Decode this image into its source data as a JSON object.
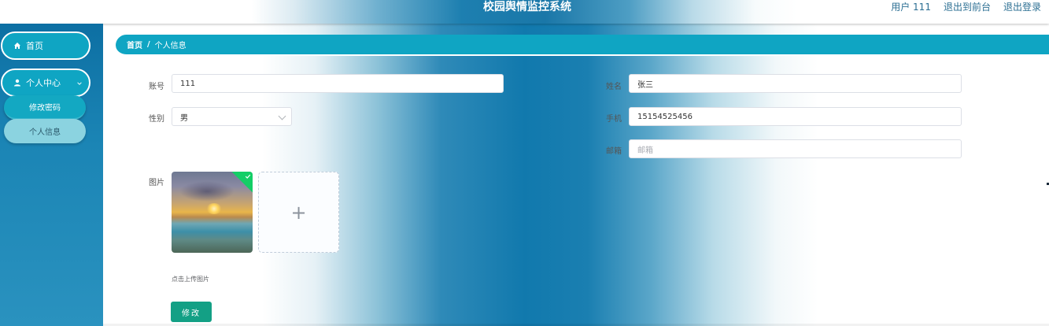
{
  "header": {
    "title": "校园舆情监控系统",
    "user_label": "用户 111",
    "to_front_label": "退出到前台",
    "logout_label": "退出登录"
  },
  "sidebar": {
    "home_label": "首页",
    "home_icon": "home-icon",
    "personal_center_label": "个人中心",
    "personal_center_icon": "user-icon",
    "sub_items": [
      "修改密码",
      "个人信息"
    ]
  },
  "breadcrumb": {
    "home": "首页",
    "separator": "/",
    "current": "个人信息"
  },
  "form": {
    "account_label": "账号",
    "account_value": "111",
    "name_label": "姓名",
    "name_value": "张三",
    "gender_label": "性别",
    "gender_value": "男",
    "phone_label": "手机",
    "phone_value": "15154525456",
    "email_label": "邮箱",
    "email_placeholder": "邮箱",
    "image_label": "图片",
    "upload_hint": "点击上传图片",
    "upload_plus": "+",
    "submit_label": "修改"
  },
  "colors": {
    "accent": "#0fa5c3",
    "submit": "#13a085",
    "success_badge": "#13ce66"
  }
}
